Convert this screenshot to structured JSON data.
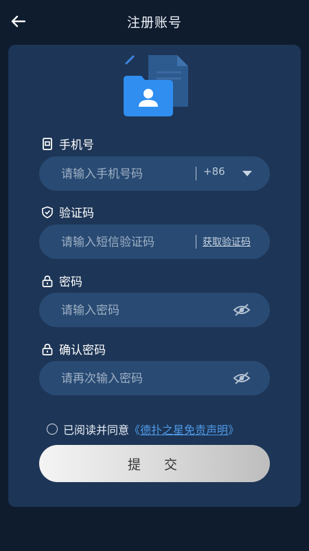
{
  "header": {
    "title": "注册账号",
    "back_icon": "arrow-left-icon"
  },
  "phone": {
    "label": "手机号",
    "placeholder": "请输入手机号码",
    "country_code": "+86"
  },
  "verify": {
    "label": "验证码",
    "placeholder": "请输入短信验证码",
    "get_code": "获取验证码"
  },
  "password": {
    "label": "密码",
    "placeholder": "请输入密码"
  },
  "confirm": {
    "label": "确认密码",
    "placeholder": "请再次输入密码"
  },
  "agreement": {
    "prefix": "已阅读并同意",
    "open_bracket": "《",
    "link": "德扑之星免责声明",
    "close_bracket": "》"
  },
  "submit_label": "提 交",
  "colors": {
    "background": "#0f1c2e",
    "card": "#1d3556",
    "field": "#284a73",
    "link": "#4f9be8"
  }
}
